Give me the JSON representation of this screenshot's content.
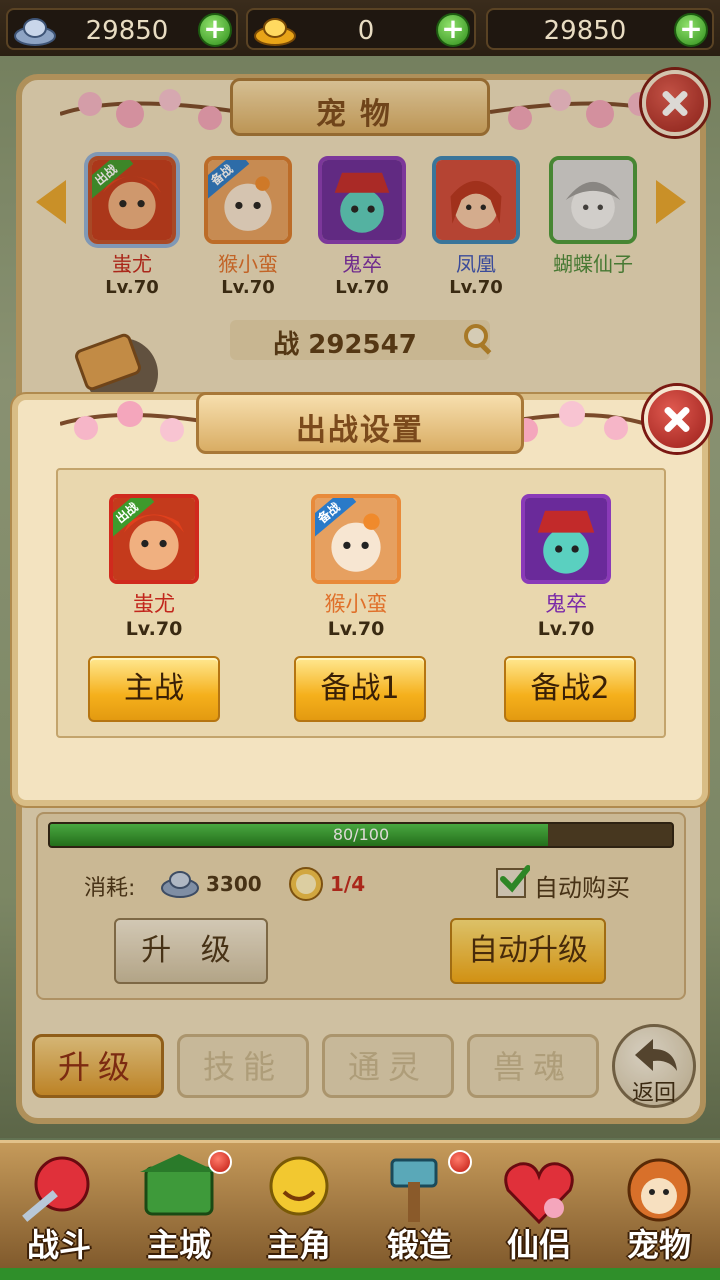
{
  "currency": [
    {
      "icon": "silver-ingot-icon",
      "value": "29850"
    },
    {
      "icon": "gold-ingot-icon",
      "value": "0"
    },
    {
      "icon": "coin-icon",
      "value": "29850"
    }
  ],
  "pet_panel": {
    "title": "宠物",
    "pets": [
      {
        "name": "蚩尤",
        "level": "Lv.70",
        "badge": "出战",
        "name_color": "#c2261c"
      },
      {
        "name": "猴小蛮",
        "level": "Lv.70",
        "badge": "备战",
        "name_color": "#e0702a"
      },
      {
        "name": "鬼卒",
        "level": "Lv.70",
        "badge": "",
        "name_color": "#7a2aa8"
      },
      {
        "name": "凤凰",
        "level": "Lv.70",
        "badge": "",
        "name_color": "#3a52b8"
      },
      {
        "name": "蝴蝶仙子",
        "level": "",
        "badge": "",
        "name_color": "#4a8a3a"
      }
    ],
    "power_label": "战 292547",
    "progress": {
      "text": "80/100",
      "value": 80,
      "max": 100
    },
    "cost_label": "消耗:",
    "cost_silver": "3300",
    "cost_item": "1/4",
    "auto_buy_label": "自动购买",
    "auto_buy_checked": true,
    "upgrade_btn": "升 级",
    "auto_upgrade_btn": "自动升级",
    "tabs": [
      {
        "label": "升级",
        "active": true
      },
      {
        "label": "技能",
        "active": false
      },
      {
        "label": "通灵",
        "active": false
      },
      {
        "label": "兽魂",
        "active": false
      }
    ],
    "back_label": "返回"
  },
  "modal": {
    "title": "出战设置",
    "slots": [
      {
        "name": "蚩尤",
        "level": "Lv.70",
        "badge": "出战",
        "name_color": "#c2261c",
        "button": "主战"
      },
      {
        "name": "猴小蛮",
        "level": "Lv.70",
        "badge": "备战",
        "name_color": "#e0702a",
        "button": "备战1"
      },
      {
        "name": "鬼卒",
        "level": "Lv.70",
        "badge": "",
        "name_color": "#7a2aa8",
        "button": "备战2"
      }
    ]
  },
  "bottom_nav": [
    {
      "label": "战斗",
      "icon": "battle-icon"
    },
    {
      "label": "主城",
      "icon": "city-icon",
      "alert": true
    },
    {
      "label": "主角",
      "icon": "hero-icon"
    },
    {
      "label": "锻造",
      "icon": "forge-icon",
      "alert": true
    },
    {
      "label": "仙侣",
      "icon": "partner-icon"
    },
    {
      "label": "宠物",
      "icon": "pet-icon"
    }
  ]
}
